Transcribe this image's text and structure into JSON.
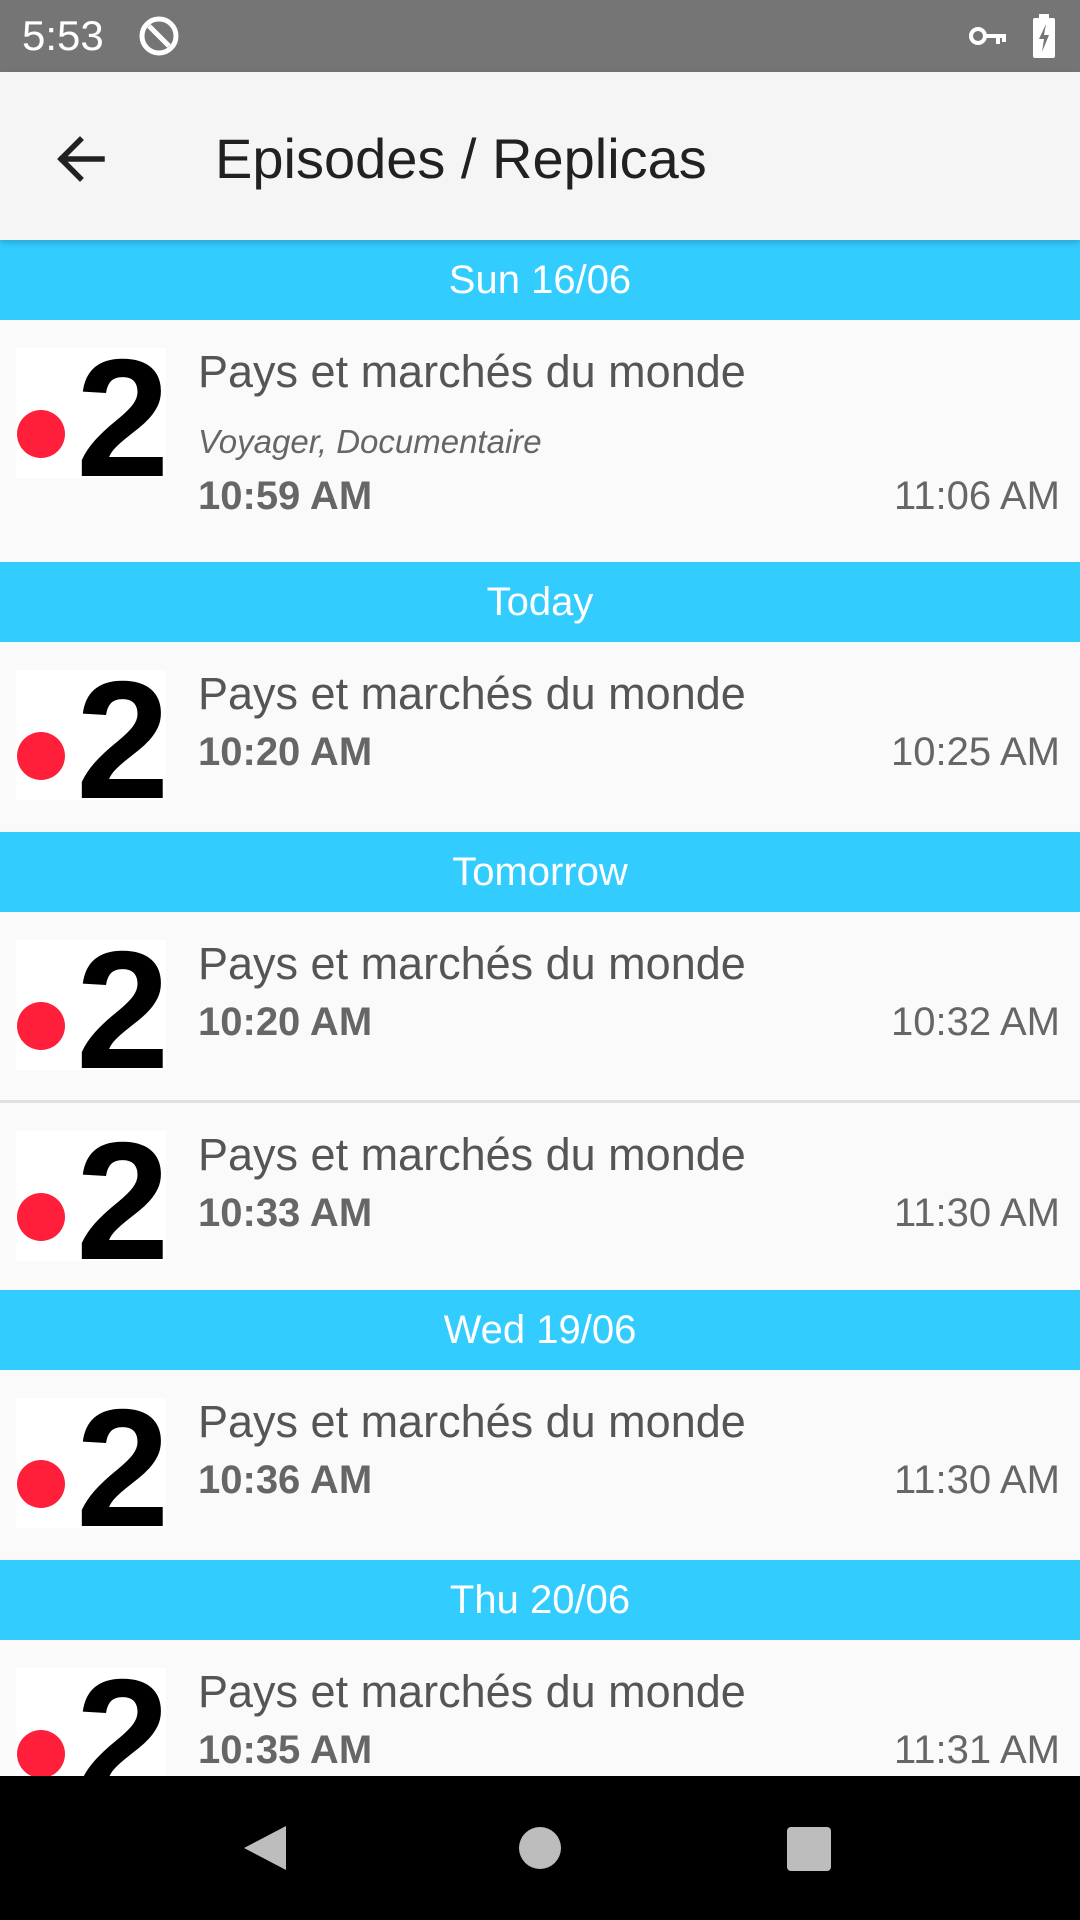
{
  "status_bar": {
    "time": "5:53"
  },
  "app_bar": {
    "title": "Episodes / Replicas"
  },
  "colors": {
    "accent": "#33ccff",
    "logo_dot": "#ff1f3a"
  },
  "sections": [
    {
      "day": "Sun 16/06",
      "episodes": [
        {
          "title": "Pays et marchés du monde",
          "genre": "Voyager, Documentaire",
          "start": "10:59 AM",
          "end": "11:06 AM"
        }
      ]
    },
    {
      "day": "Today",
      "episodes": [
        {
          "title": "Pays et marchés du monde",
          "start": "10:20 AM",
          "end": "10:25 AM"
        }
      ]
    },
    {
      "day": "Tomorrow",
      "episodes": [
        {
          "title": "Pays et marchés du monde",
          "start": "10:20 AM",
          "end": "10:32 AM"
        },
        {
          "title": "Pays et marchés du monde",
          "start": "10:33 AM",
          "end": "11:30 AM"
        }
      ]
    },
    {
      "day": "Wed 19/06",
      "episodes": [
        {
          "title": "Pays et marchés du monde",
          "start": "10:36 AM",
          "end": "11:30 AM"
        }
      ]
    },
    {
      "day": "Thu 20/06",
      "episodes": [
        {
          "title": "Pays et marchés du monde",
          "start": "10:35 AM",
          "end": "11:31 AM"
        }
      ]
    }
  ]
}
